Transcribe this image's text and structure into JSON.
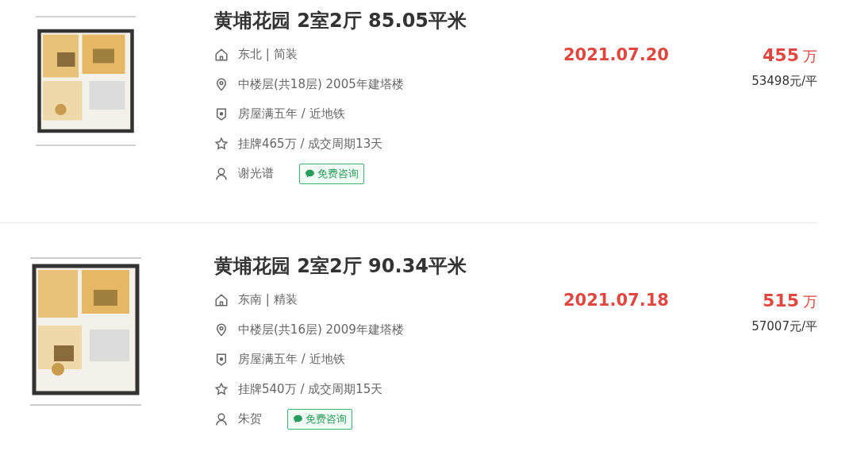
{
  "listings": [
    {
      "title": "黄埔花园 2室2厅 85.05平米",
      "info": [
        {
          "kind": "house",
          "text": "东北 | 简装"
        },
        {
          "kind": "location",
          "text": "中楼层(共18层) 2005年建塔楼"
        },
        {
          "kind": "badge",
          "text": "房屋满五年 / 近地铁"
        },
        {
          "kind": "star",
          "text": "挂牌465万 / 成交周期13天"
        }
      ],
      "agent": "谢光谱",
      "consult": "免费咨询",
      "date": "2021.07.20",
      "price": "455",
      "price_unit": "万",
      "unit_price": "53498元/平"
    },
    {
      "title": "黄埔花园 2室2厅 90.34平米",
      "info": [
        {
          "kind": "house",
          "text": "东南 | 精装"
        },
        {
          "kind": "location",
          "text": "中楼层(共16层) 2009年建塔楼"
        },
        {
          "kind": "badge",
          "text": "房屋满五年 / 近地铁"
        },
        {
          "kind": "star",
          "text": "挂牌540万 / 成交周期15天"
        }
      ],
      "agent": "朱贺",
      "consult": "免费咨询",
      "date": "2021.07.18",
      "price": "515",
      "price_unit": "万",
      "unit_price": "57007元/平"
    }
  ]
}
